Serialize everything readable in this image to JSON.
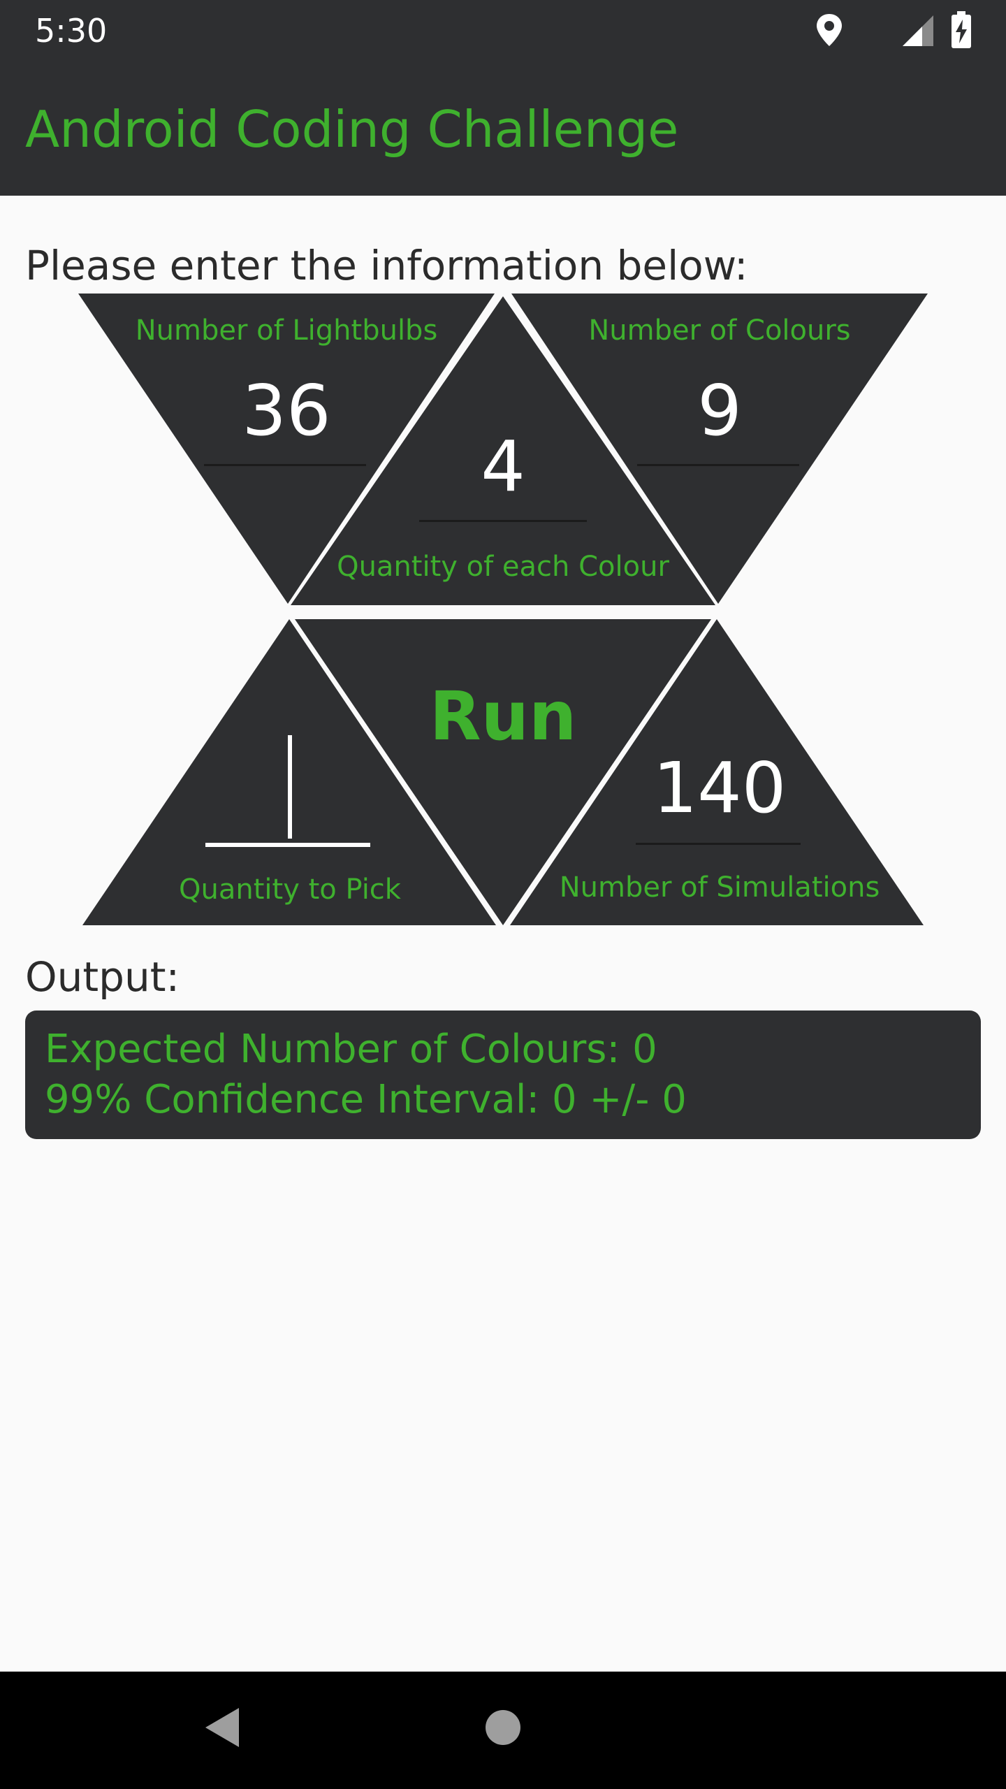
{
  "status_bar": {
    "time": "5:30",
    "icons": [
      "location-icon",
      "signal-icon",
      "battery-charging-icon"
    ]
  },
  "app_bar": {
    "title": "Android Coding Challenge"
  },
  "form": {
    "prompt": "Please enter the information below:",
    "fields": {
      "lightbulbs": {
        "label": "Number of Lightbulbs",
        "value": "36"
      },
      "colours": {
        "label": "Number of Colours",
        "value": "9"
      },
      "quantity_each": {
        "label": "Quantity of each Colour",
        "value": "4"
      },
      "quantity_pick": {
        "label": "Quantity to Pick",
        "value": ""
      },
      "simulations": {
        "label": "Number of Simulations",
        "value": "140"
      }
    },
    "run_label": "Run"
  },
  "output": {
    "label": "Output:",
    "lines": [
      "Expected Number of Colours: 0",
      "99% Confidence Interval: 0 +/- 0"
    ]
  },
  "nav_bar": {
    "icons": [
      "back-icon",
      "home-icon"
    ]
  },
  "colors": {
    "accent": "#3fb12e",
    "dark": "#2e2f31",
    "background": "#fafafa"
  }
}
